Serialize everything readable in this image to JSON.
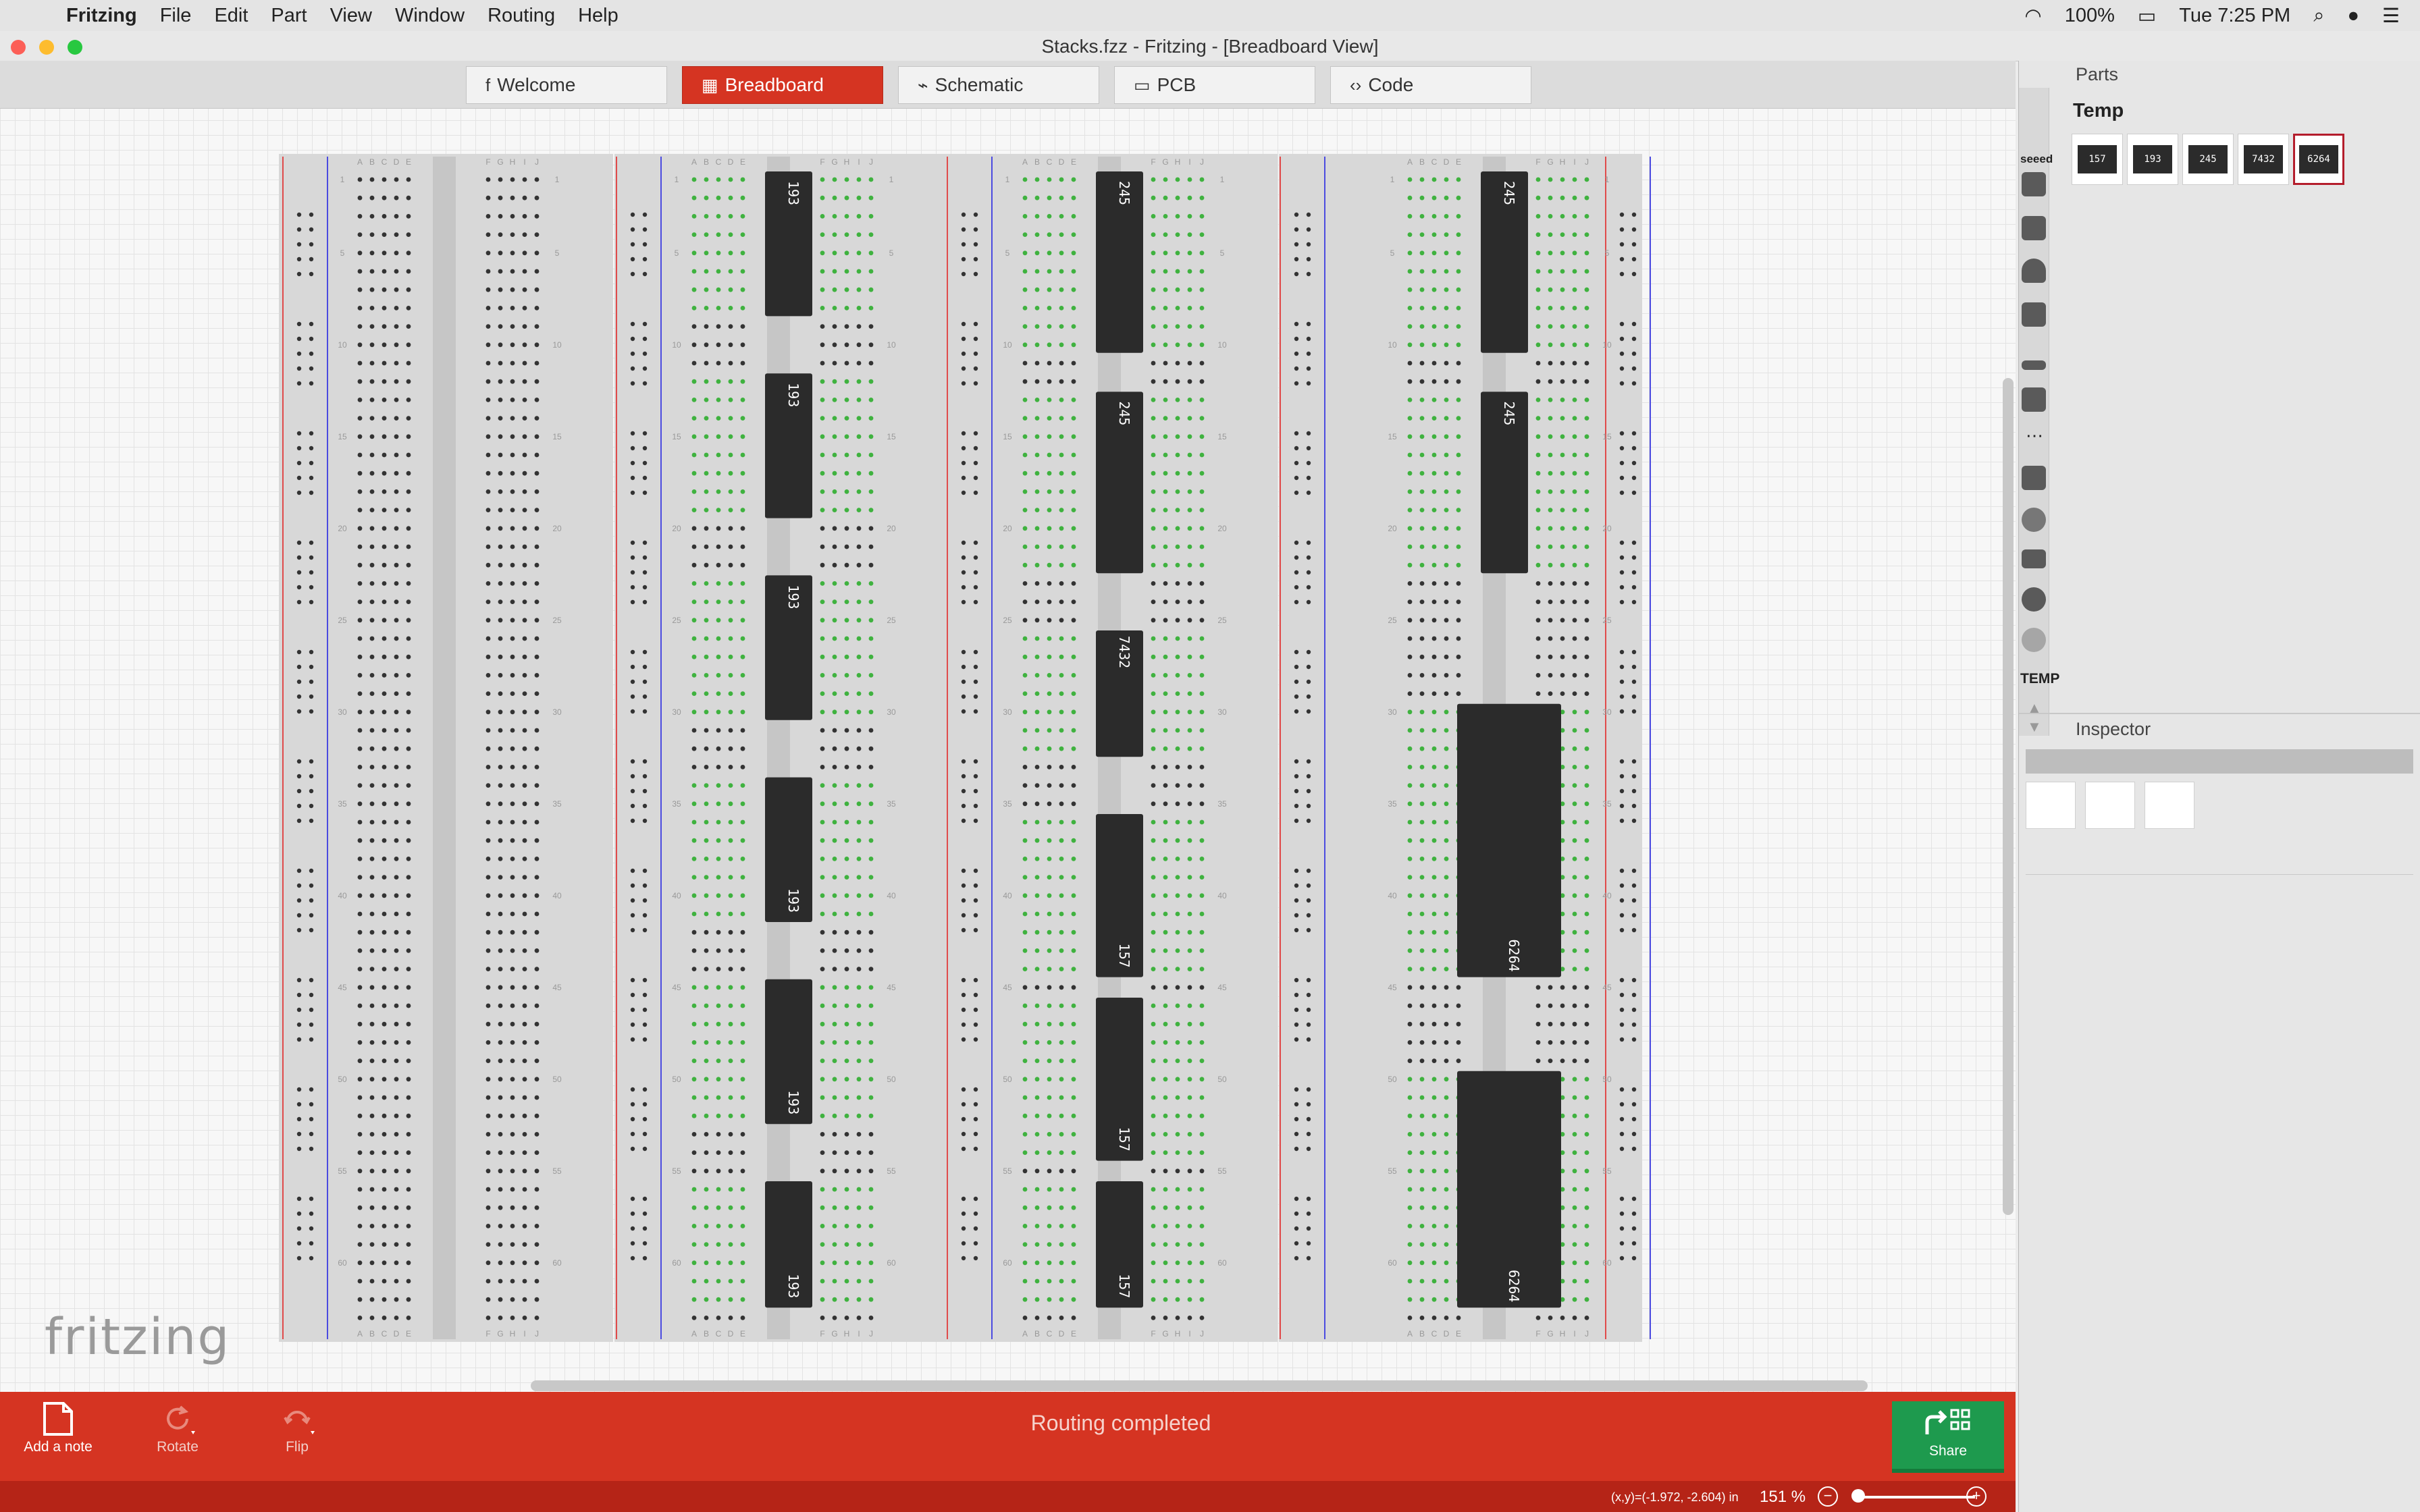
{
  "menubar": {
    "app": "Fritzing",
    "items": [
      "File",
      "Edit",
      "Part",
      "View",
      "Window",
      "Routing",
      "Help"
    ],
    "battery": "100%",
    "clock": "Tue 7:25 PM"
  },
  "window": {
    "title": "Stacks.fzz - Fritzing - [Breadboard View]"
  },
  "tabs": [
    {
      "label": "Welcome",
      "icon": "f"
    },
    {
      "label": "Breadboard",
      "icon": "▦"
    },
    {
      "label": "Schematic",
      "icon": "⌁"
    },
    {
      "label": "PCB",
      "icon": "▭"
    },
    {
      "label": "Code",
      "icon": "‹›"
    }
  ],
  "breadboard": {
    "columns": [
      "A",
      "B",
      "C",
      "D",
      "E",
      "F",
      "G",
      "H",
      "I",
      "J"
    ],
    "row_numbers": [
      "1",
      "5",
      "10",
      "15",
      "20",
      "25",
      "30",
      "35",
      "40",
      "45",
      "50",
      "55",
      "60"
    ],
    "chips": [
      {
        "label": "193"
      },
      {
        "label": "193"
      },
      {
        "label": "193"
      },
      {
        "label": "193"
      },
      {
        "label": "193"
      },
      {
        "label": "193"
      },
      {
        "label": "245"
      },
      {
        "label": "245"
      },
      {
        "label": "7432"
      },
      {
        "label": "157"
      },
      {
        "label": "157"
      },
      {
        "label": "157"
      },
      {
        "label": "245"
      },
      {
        "label": "245"
      },
      {
        "label": "6264"
      },
      {
        "label": "6264"
      }
    ]
  },
  "logo": "fritzing",
  "toolbar": {
    "add_note": "Add a note",
    "rotate": "Rotate",
    "flip": "Flip",
    "status": "Routing completed",
    "share": "Share"
  },
  "statusbar": {
    "coords": "(x,y)=(-1.972, -2.604) in",
    "zoom": "151 %"
  },
  "parts": {
    "header": "Parts",
    "bin_title": "Temp",
    "bin_label": "TEMP",
    "seeed": "seeed",
    "tiles": [
      "157",
      "193",
      "245",
      "7432",
      "6264"
    ]
  },
  "inspector": {
    "header": "Inspector"
  },
  "colors": {
    "accent": "#d53422",
    "share": "#1e9a4e",
    "chip": "#2b2b2b",
    "connected_hole": "#3fb23f"
  }
}
